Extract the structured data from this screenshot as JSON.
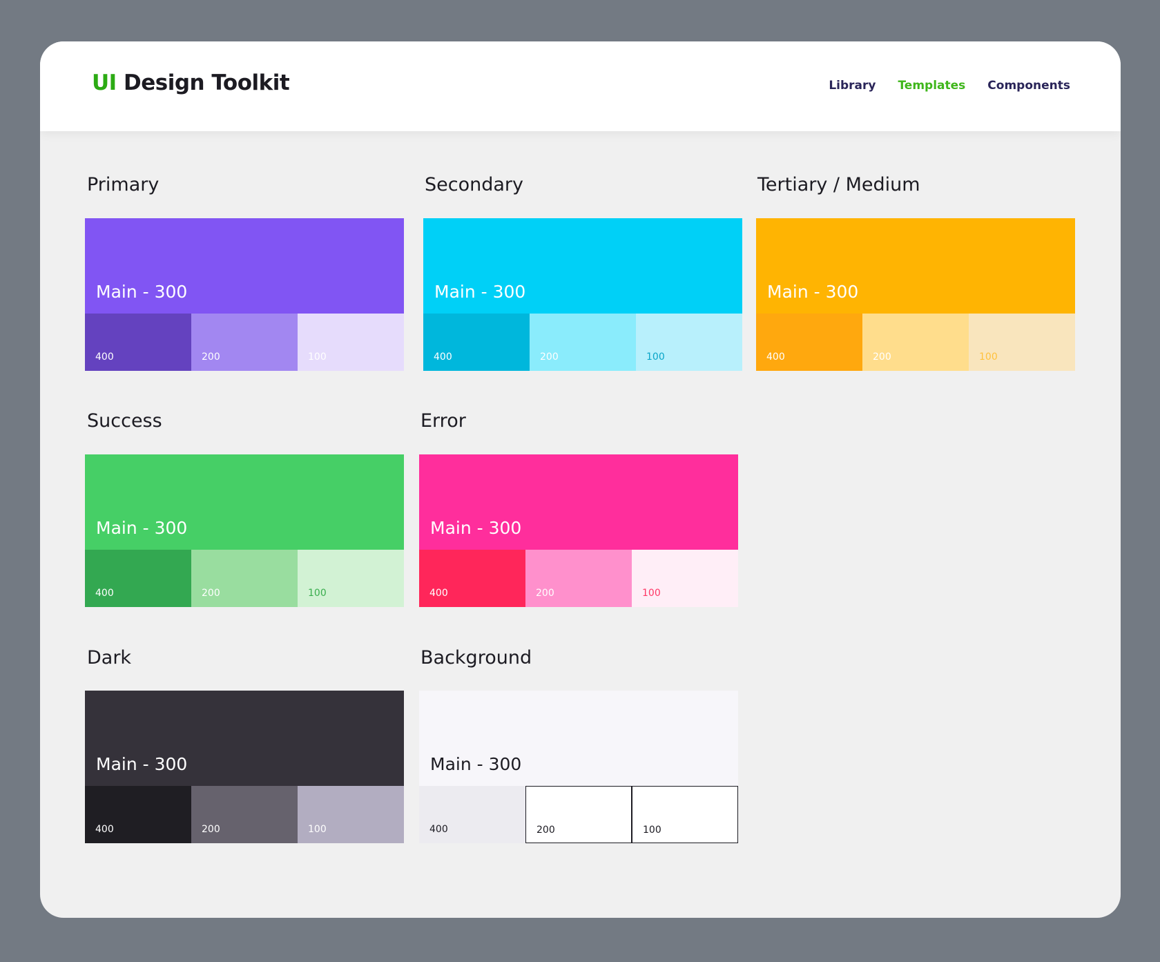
{
  "header": {
    "logo_accent": "UI",
    "logo_text": " Design Toolkit",
    "nav": [
      {
        "label": "Library",
        "active": false
      },
      {
        "label": "Templates",
        "active": true
      },
      {
        "label": "Components",
        "active": false
      }
    ]
  },
  "colors": {
    "logo_accent": "#2cab14",
    "nav_text": "#2a2559",
    "nav_active": "#3fb61b"
  },
  "palettes": [
    {
      "id": "primary",
      "title": "Primary",
      "main_label": "Main - 300",
      "main_color": "#8155f3",
      "main_text_color": "#ffffff",
      "tints": [
        {
          "label": "400",
          "color": "#6442bf",
          "text_color": "#ffffff"
        },
        {
          "label": "200",
          "color": "#a287f1",
          "text_color": "#ffffff"
        },
        {
          "label": "100",
          "color": "#e6dcfc",
          "text_color": "#ffffff"
        }
      ]
    },
    {
      "id": "secondary",
      "title": "Secondary",
      "main_label": "Main - 300",
      "main_color": "#00d0f7",
      "main_text_color": "#ffffff",
      "tints": [
        {
          "label": "400",
          "color": "#00b7dc",
          "text_color": "#ffffff"
        },
        {
          "label": "200",
          "color": "#8aecfc",
          "text_color": "#ffffff"
        },
        {
          "label": "100",
          "color": "#b8f0fc",
          "text_color": "#0aa5c8"
        }
      ]
    },
    {
      "id": "tertiary",
      "title": "Tertiary / Medium",
      "main_label": "Main - 300",
      "main_color": "#ffb402",
      "main_text_color": "#ffffff",
      "tints": [
        {
          "label": "400",
          "color": "#ffa80e",
          "text_color": "#ffffff"
        },
        {
          "label": "200",
          "color": "#ffdd8c",
          "text_color": "#ffffff"
        },
        {
          "label": "100",
          "color": "#f9e5bd",
          "text_color": "#ffc13c"
        }
      ]
    },
    {
      "id": "success",
      "title": "Success",
      "main_label": "Main - 300",
      "main_color": "#46cf66",
      "main_text_color": "#ffffff",
      "tints": [
        {
          "label": "400",
          "color": "#33a851",
          "text_color": "#ffffff"
        },
        {
          "label": "200",
          "color": "#99dd9f",
          "text_color": "#ffffff"
        },
        {
          "label": "100",
          "color": "#d2f2d4",
          "text_color": "#3aad4e"
        }
      ]
    },
    {
      "id": "error",
      "title": "Error",
      "main_label": "Main - 300",
      "main_color": "#ff2e9c",
      "main_text_color": "#ffffff",
      "tints": [
        {
          "label": "400",
          "color": "#ff265a",
          "text_color": "#ffffff"
        },
        {
          "label": "200",
          "color": "#ff90cc",
          "text_color": "#ffffff"
        },
        {
          "label": "100",
          "color": "#ffeef7",
          "text_color": "#ff3866"
        }
      ]
    },
    {
      "id": "dark",
      "title": "Dark",
      "main_label": "Main - 300",
      "main_color": "#35323a",
      "main_text_color": "#ffffff",
      "tints": [
        {
          "label": "400",
          "color": "#1f1e23",
          "text_color": "#ffffff"
        },
        {
          "label": "200",
          "color": "#66626d",
          "text_color": "#ffffff"
        },
        {
          "label": "100",
          "color": "#b2adc1",
          "text_color": "#ffffff"
        }
      ]
    },
    {
      "id": "background",
      "title": "Background",
      "main_label": "Main - 300",
      "main_color": "#f7f6fa",
      "main_text_color": "#1c1b22",
      "tints": [
        {
          "label": "400",
          "color": "#ecebf0",
          "text_color": "#1c1b22",
          "bordered": false
        },
        {
          "label": "200",
          "color": "#ffffff",
          "text_color": "#1c1b22",
          "bordered": true
        },
        {
          "label": "100",
          "color": "#ffffff",
          "text_color": "#1c1b22",
          "bordered": true
        }
      ]
    }
  ]
}
